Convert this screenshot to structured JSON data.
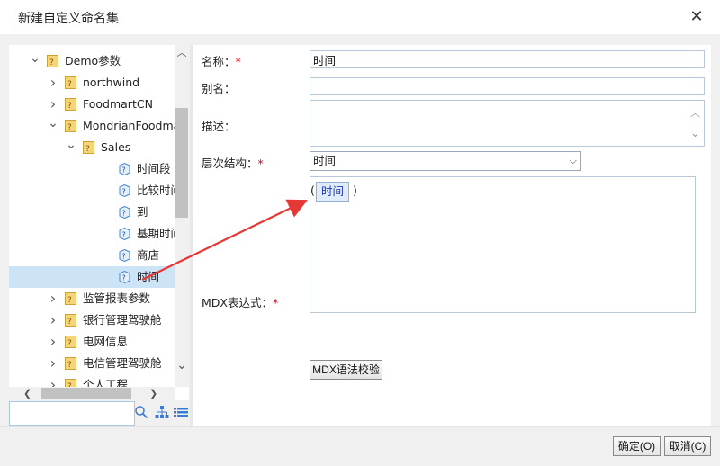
{
  "dialog": {
    "title": "新建自定义命名集"
  },
  "tree": {
    "items": [
      {
        "label": "Demo参数",
        "toggle": "expanded",
        "type": "folder"
      },
      {
        "label": "northwind",
        "toggle": "collapsed",
        "type": "folder"
      },
      {
        "label": "FoodmartCN",
        "toggle": "collapsed",
        "type": "folder"
      },
      {
        "label": "MondrianFoodmart",
        "toggle": "expanded",
        "type": "folder"
      },
      {
        "label": "Sales",
        "toggle": "expanded",
        "type": "folder"
      },
      {
        "label": "时间段",
        "toggle": "none",
        "type": "cube"
      },
      {
        "label": "比较时间",
        "toggle": "none",
        "type": "cube"
      },
      {
        "label": "到",
        "toggle": "none",
        "type": "cube"
      },
      {
        "label": "基期时间",
        "toggle": "none",
        "type": "cube"
      },
      {
        "label": "商店",
        "toggle": "none",
        "type": "cube"
      },
      {
        "label": "时间",
        "toggle": "none",
        "type": "cube",
        "selected": true
      },
      {
        "label": "监管报表参数",
        "toggle": "collapsed",
        "type": "folder"
      },
      {
        "label": "银行管理驾驶舱",
        "toggle": "collapsed",
        "type": "folder"
      },
      {
        "label": "电网信息",
        "toggle": "collapsed",
        "type": "folder"
      },
      {
        "label": "电信管理驾驶舱",
        "toggle": "collapsed",
        "type": "folder"
      },
      {
        "label": "个人工程",
        "toggle": "collapsed",
        "type": "folder"
      }
    ],
    "search_placeholder": ""
  },
  "form": {
    "name_label": "名称：",
    "name_value": "时间",
    "alias_label": "别名：",
    "alias_value": "",
    "desc_label": "描述：",
    "hierarchy_label": "层次结构：",
    "hierarchy_value": "时间",
    "mdx_label": "MDX表达式：",
    "mdx_open": "(",
    "mdx_token": "时间",
    "mdx_close": ")",
    "required_mark": "*",
    "validate_button": "MDX语法校验"
  },
  "footer": {
    "ok_button": "确定(O)",
    "cancel_button": "取消(C)"
  },
  "colors": {
    "selected_row": "#cde4f7",
    "arrow": "#e53935",
    "token_text": "#1e3bb8",
    "required": "#d0021b"
  }
}
